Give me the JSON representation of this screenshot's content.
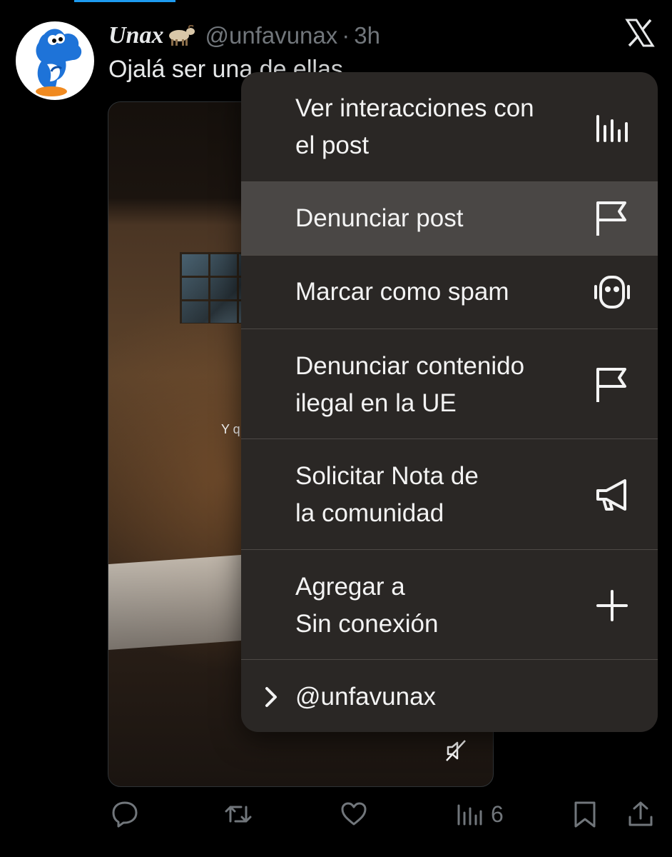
{
  "post": {
    "display_name": "Unax",
    "handle": "@unfavunax",
    "separator": "·",
    "time": "3h",
    "text": "Ojalá ser una de ellas",
    "video_caption": "Y q"
  },
  "menu": {
    "items": [
      {
        "label": "Ver interacciones con\nel post",
        "icon": "chart-bars-icon"
      },
      {
        "label": "Denunciar post",
        "icon": "flag-icon"
      },
      {
        "label": "Marcar como spam",
        "icon": "robot-icon"
      },
      {
        "label": "Denunciar contenido\nilegal en la UE",
        "icon": "flag-icon"
      },
      {
        "label": "Solicitar Nota de\nla comunidad",
        "icon": "megaphone-icon"
      },
      {
        "label": "Agregar a\nSin conexión",
        "icon": "plus-icon"
      },
      {
        "label": "@unfavunax",
        "icon": "chevron-right-icon"
      }
    ]
  },
  "actions": {
    "views_count": "6"
  },
  "colors": {
    "background": "#000000",
    "menu_background": "#2a2725",
    "menu_highlight": "#4a4745",
    "text_primary": "#e7e9ea",
    "text_secondary": "#71767b",
    "accent_blue": "#1d9bf0"
  }
}
